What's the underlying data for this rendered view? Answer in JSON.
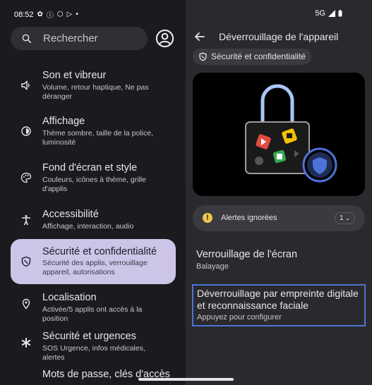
{
  "status_bar": {
    "time": "08:52",
    "network": "5G"
  },
  "left_panel": {
    "search_placeholder": "Rechercher",
    "items": [
      {
        "title": "Son et vibreur",
        "subtitle": "Volume, retour haptique, Ne pas déranger",
        "icon": "speaker-icon"
      },
      {
        "title": "Affichage",
        "subtitle": "Thème sombre, taille de la police, luminosité",
        "icon": "brightness-icon"
      },
      {
        "title": "Fond d'écran et style",
        "subtitle": "Couleurs, icônes à thème, grille d'applis",
        "icon": "palette-icon"
      },
      {
        "title": "Accessibilité",
        "subtitle": "Affichage, interaction, audio",
        "icon": "accessibility-icon"
      },
      {
        "title": "Sécurité et confidentialité",
        "subtitle": "Sécurité des applis, verrouillage appareil, autorisations",
        "icon": "shield-icon"
      },
      {
        "title": "Localisation",
        "subtitle": "Activée/5 applis ont accès à la position",
        "icon": "location-pin-icon"
      },
      {
        "title": "Sécurité et urgences",
        "subtitle": "SOS Urgence, infos médicales, alertes",
        "icon": "asterisk-icon"
      },
      {
        "title": "Mots de passe, clés d'accès",
        "subtitle": "",
        "icon": ""
      }
    ]
  },
  "right_panel": {
    "title": "Déverrouillage de l'appareil",
    "breadcrumb_chip": "Sécurité et confidentialité",
    "alerts": {
      "label": "Alertes ignorées",
      "count": "1"
    },
    "screen_lock": {
      "title": "Verrouillage de l'écran",
      "subtitle": "Balayage"
    },
    "fingerprint": {
      "title": "Déverrouillage par empreinte digitale et reconnaissance faciale",
      "subtitle": "Appuyez pour configurer"
    }
  },
  "colors": {
    "selected_bg": "#cdc5e8",
    "accent_blue": "#4c73d6",
    "warning": "#f3c74b"
  }
}
